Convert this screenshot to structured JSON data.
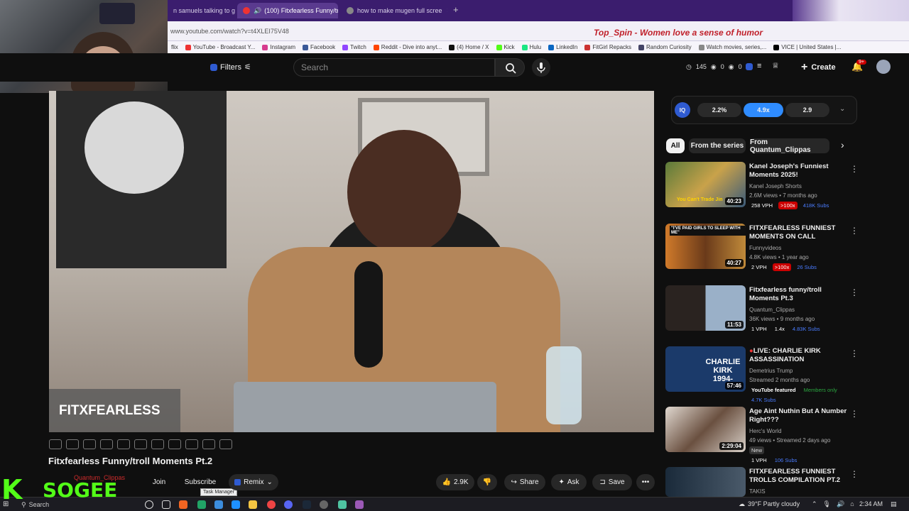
{
  "browser": {
    "tabs": [
      {
        "label": "n samuels talking to g"
      },
      {
        "label": "(100) Fitxfearless Funny/tr"
      },
      {
        "label": "how to make mugen full scree"
      }
    ],
    "url": "www.youtube.com/watch?v=t4XLEI75V48",
    "overlay_text": "Top_Spin - Women love a sense of humor",
    "bookmarks": [
      "flix",
      "YouTube - Broadcast Y...",
      "Instagram",
      "Facebook",
      "Twitch",
      "Reddit - Dive into anyt...",
      "(4) Home / X",
      "Kick",
      "Hulu",
      "LinkedIn",
      "FitGirl Repacks",
      "Random Curiosity",
      "Watch movies, series,...",
      "VICE | United States |..."
    ]
  },
  "header": {
    "filters_label": "Filters",
    "search_placeholder": "Search",
    "stats": [
      "145",
      "0",
      "0"
    ],
    "create_label": "Create",
    "notif_badge": "9+"
  },
  "video": {
    "watermark": "FITXFEARLESS",
    "title": "Fitxfearless Funny/troll Moments Pt.2",
    "channel": "Quantum_Clippas",
    "join": "Join",
    "subscribe": "Subscribe",
    "tooltip": "Task Manager",
    "remix": "Remix",
    "likes": "2.9K",
    "share": "Share",
    "ask": "Ask",
    "save": "Save"
  },
  "iq_panel": {
    "badge": "IQ",
    "values": [
      "2.2%",
      "4.9x",
      "2.9"
    ]
  },
  "chips": [
    "All",
    "From the series",
    "From Quantum_Clippas"
  ],
  "recommendations": [
    {
      "title": "Kanel Joseph's Funniest Moments 2025!",
      "channel": "Kanel Joseph Shorts",
      "meta": "2.6M views • 7 months ago",
      "duration": "40:23",
      "stats": [
        "258 VPH",
        ">100x",
        "418K Subs"
      ],
      "thumb_text": "You Can't Trade Jin"
    },
    {
      "title": "FITXFEARLESS FUNNIEST MOMENTS ON CALL",
      "channel": "Funnyvideos",
      "meta": "4.8K views • 1 year ago",
      "duration": "40:27",
      "stats": [
        "2 VPH",
        ">100x",
        "26 Subs"
      ],
      "thumb_text": "\"I'VE PAID GIRLS TO SLEEP WITH ME\""
    },
    {
      "title": "Fitxfearless funny/troll Moments Pt.3",
      "channel": "Quantum_Clippas",
      "meta": "36K views • 9 months ago",
      "duration": "11:53",
      "stats": [
        "1 VPH",
        "1.4x",
        "4.83K Subs"
      ],
      "thumb_text": ""
    },
    {
      "title": "LIVE: CHARLIE KIRK ASSASSINATION",
      "channel": "Demetrius Trump",
      "meta": "Streamed 2 months ago",
      "duration": "57:46",
      "stats": [
        "YouTube featured",
        "Members only",
        "4.7K Subs"
      ],
      "thumb_text": "CHARLIE KIRK 1994-"
    },
    {
      "title": "Age Aint Nuthin But A Number Right???",
      "channel": "Herc's World",
      "meta": "49 views • Streamed 2 days ago",
      "duration": "2:29:04",
      "stats": [
        "New",
        "1 VPH",
        "106 Subs"
      ],
      "thumb_text": ""
    },
    {
      "title": "FITXFEARLESS FUNNIEST TROLLS COMPILATION PT.2",
      "channel": "TAKIS",
      "meta": "",
      "duration": "",
      "stats": [],
      "thumb_text": ""
    }
  ],
  "taskbar": {
    "search": "Search",
    "logo_text": "SOGEE",
    "weather": "39°F  Partly cloudy",
    "time": "2:34 AM"
  }
}
